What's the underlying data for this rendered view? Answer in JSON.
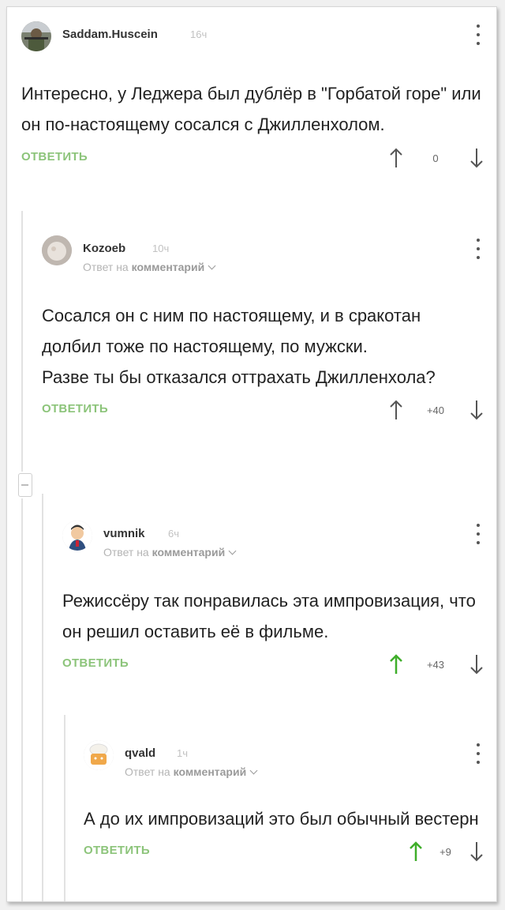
{
  "colors": {
    "accent": "#8cc47a",
    "up_active": "#3fae2a",
    "icon": "#555555"
  },
  "comments": [
    {
      "author": "Saddam.Huscein",
      "time": "16ч",
      "reply_to": "",
      "text": "Интересно, у Леджера был дублёр в \"Горбатой горе\" или он по-настоящему сосался с Джилленхолом.",
      "reply_label": "ОТВЕТИТЬ",
      "score": "0",
      "upvoted": false,
      "avatar_icon": "soldier-avatar-icon"
    },
    {
      "author": "Kozoeb",
      "time": "10ч",
      "reply_to_prefix": "Ответ на",
      "reply_to": "комментарий",
      "text": "Сосался он с ним по настоящему, и в сракотан долбил тоже по настоящему, по мужски.\nРазве ты бы отказался оттрахать Джилленхола?",
      "reply_label": "ОТВЕТИТЬ",
      "score": "+40",
      "upvoted": false,
      "avatar_icon": "blurry-avatar-icon"
    },
    {
      "author": "vumnik",
      "time": "6ч",
      "reply_to_prefix": "Ответ на",
      "reply_to": "комментарий",
      "text": "Режиссёру так понравилась эта импровизация, что он решил оставить её в фильме.",
      "reply_label": "ОТВЕТИТЬ",
      "score": "+43",
      "upvoted": true,
      "avatar_icon": "cartoon-man-avatar-icon"
    },
    {
      "author": "qvald",
      "time": "1ч",
      "reply_to_prefix": "Ответ на",
      "reply_to": "комментарий",
      "text": "А до их импровизаций это был обычный вестерн",
      "reply_label": "ОТВЕТИТЬ",
      "score": "+9",
      "upvoted": true,
      "avatar_icon": "chef-avatar-icon"
    }
  ]
}
